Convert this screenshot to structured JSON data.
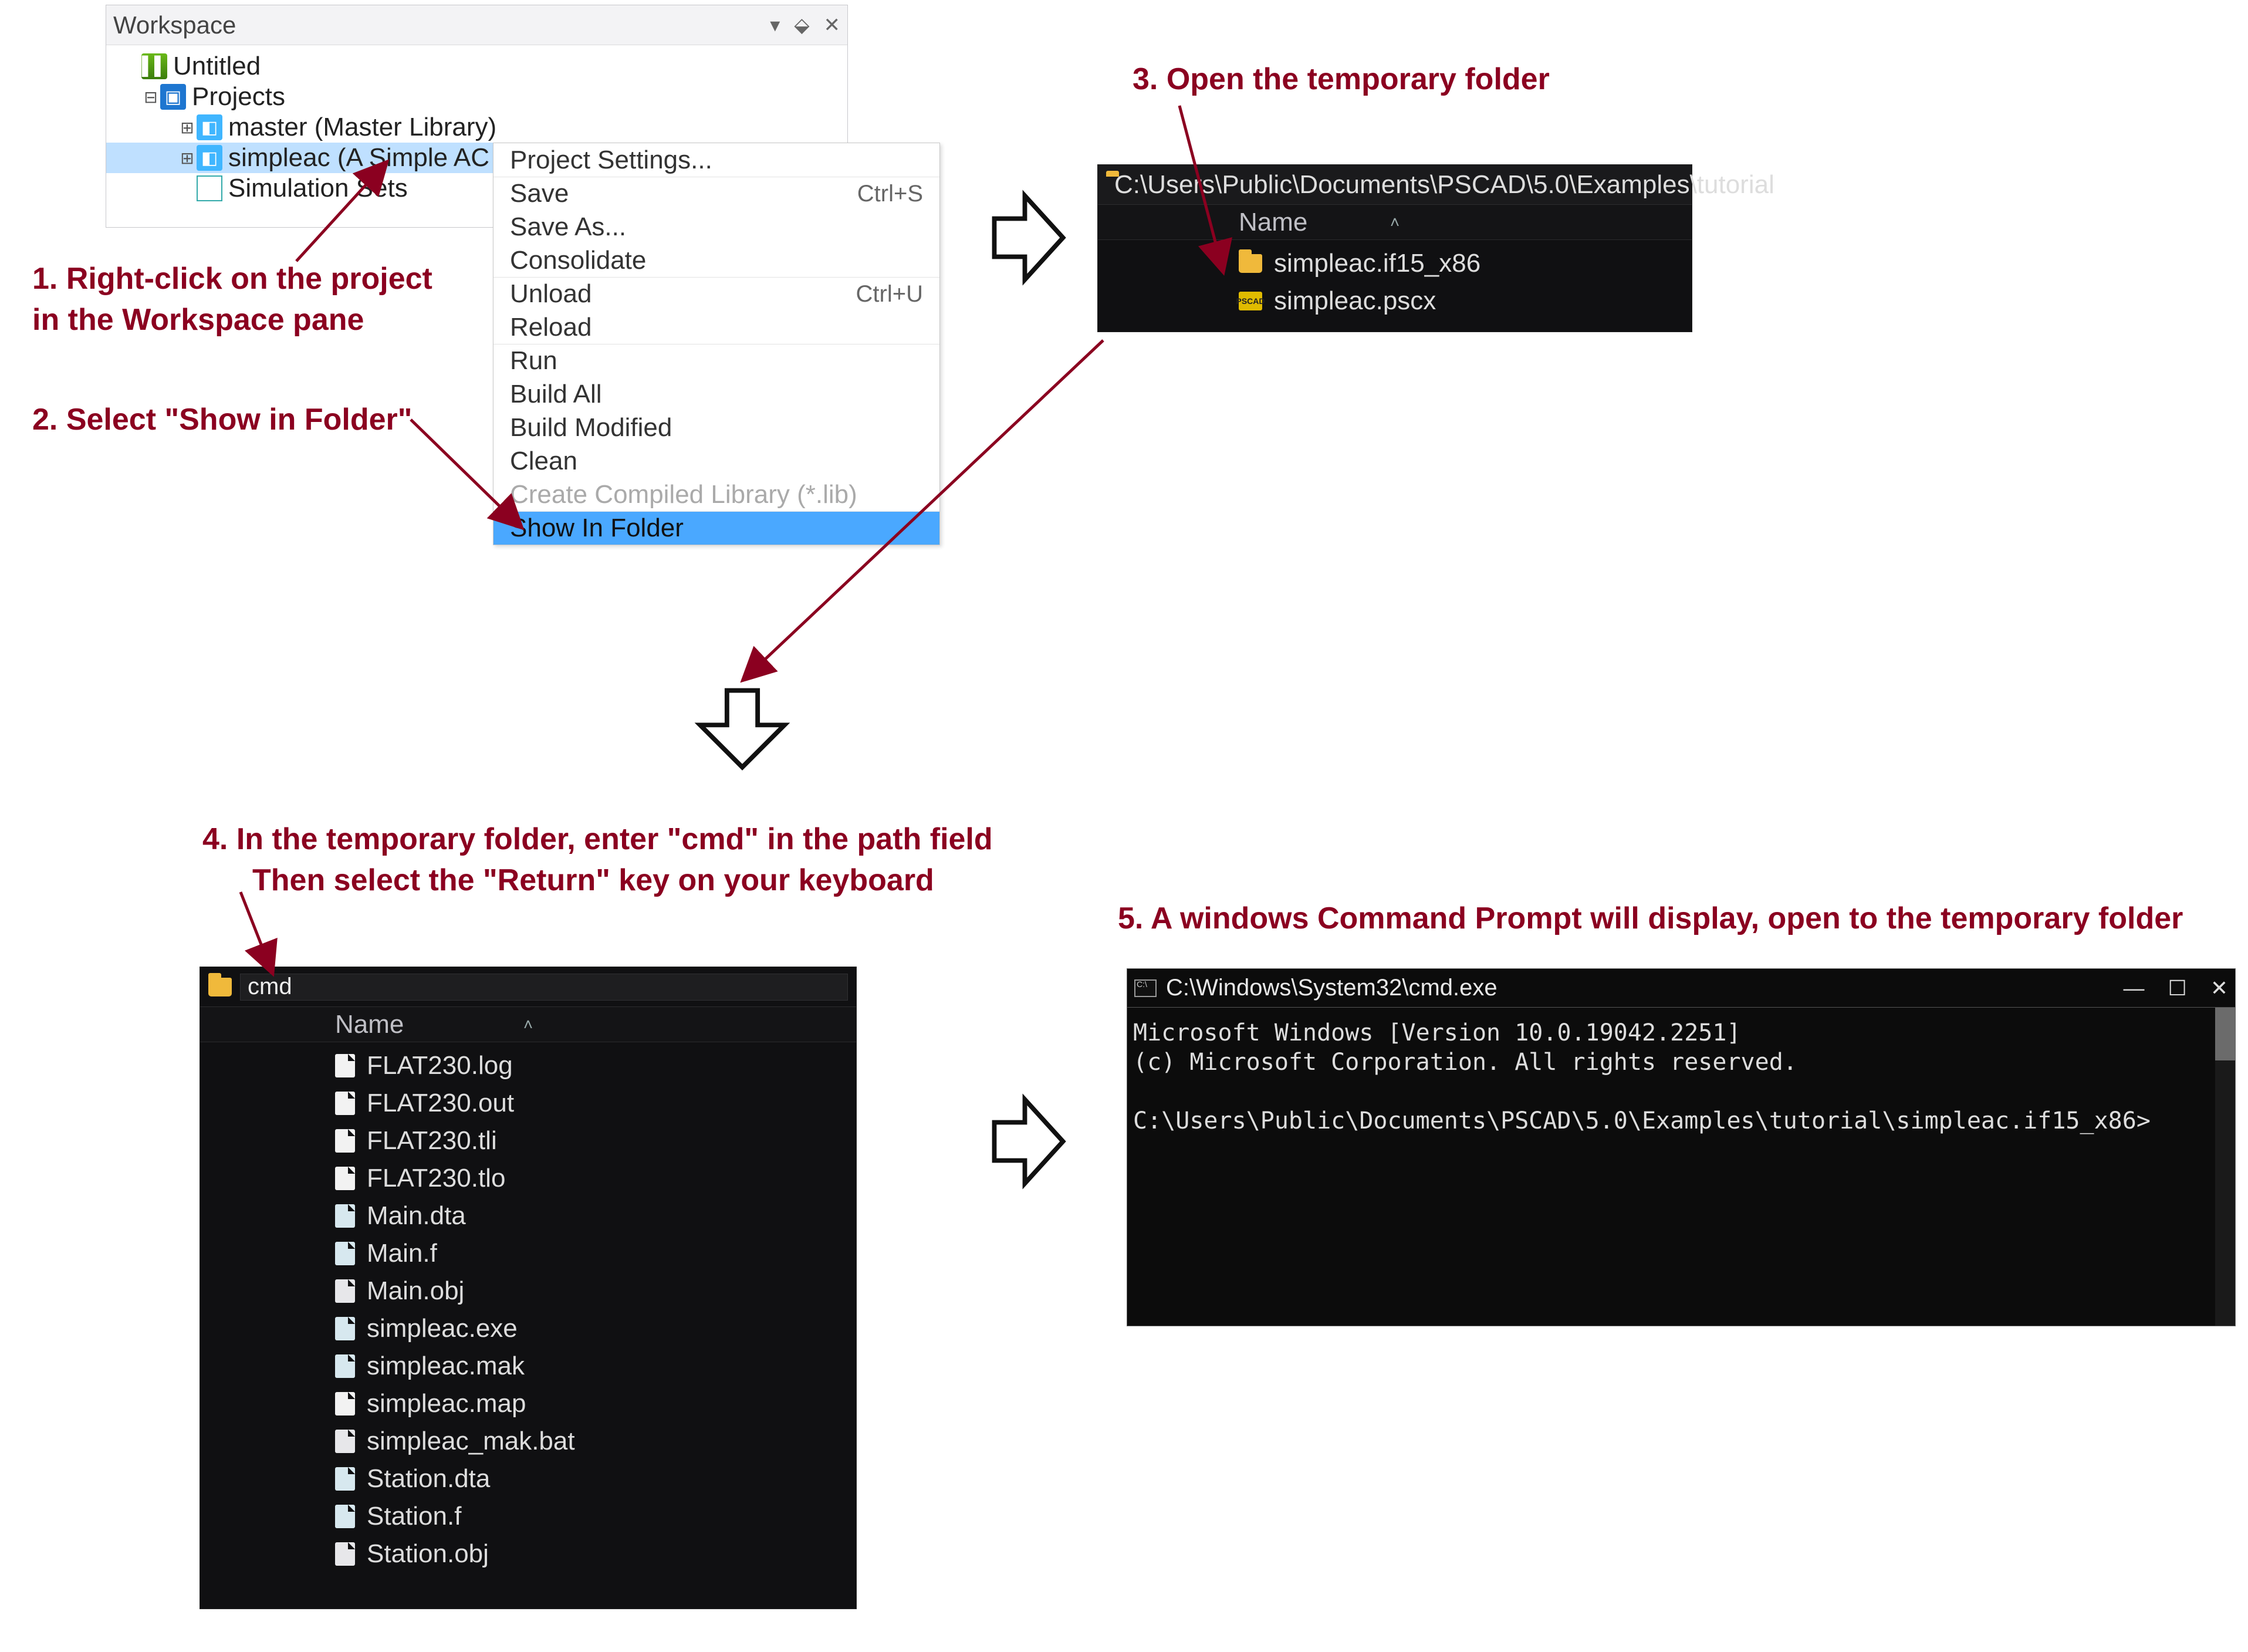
{
  "annotations": {
    "s1a": "1. Right-click on the project",
    "s1b": "in the Workspace pane",
    "s2": "2. Select \"Show in Folder\"",
    "s3": "3. Open the temporary folder",
    "s4a": "4. In the temporary folder, enter \"cmd\" in the path field",
    "s4b": "Then select the \"Return\" key on your keyboard",
    "s5": "5. A windows Command Prompt will display, open to the temporary folder"
  },
  "workspace": {
    "title": "Workspace",
    "tree": {
      "root": "Untitled",
      "projects": "Projects",
      "master": "master (Master Library)",
      "simpleac": "simpleac (A Simple AC Power System)",
      "simsets": "Simulation Sets"
    }
  },
  "context_menu": {
    "project_settings": "Project Settings...",
    "save": "Save",
    "save_kbd": "Ctrl+S",
    "save_as": "Save As...",
    "consolidate": "Consolidate",
    "unload": "Unload",
    "unload_kbd": "Ctrl+U",
    "reload": "Reload",
    "run": "Run",
    "build_all": "Build All",
    "build_modified": "Build Modified",
    "clean": "Clean",
    "create_lib": "Create Compiled Library (*.lib)",
    "show_in_folder": "Show In Folder"
  },
  "explorer1": {
    "path": "C:\\Users\\Public\\Documents\\PSCAD\\5.0\\Examples\\tutorial",
    "col_name": "Name",
    "items": {
      "folder": "simpleac.if15_x86",
      "pscx": "simpleac.pscx"
    }
  },
  "explorer2": {
    "addr_value": "cmd",
    "col_name": "Name",
    "files": [
      "FLAT230.log",
      "FLAT230.out",
      "FLAT230.tli",
      "FLAT230.tlo",
      "Main.dta",
      "Main.f",
      "Main.obj",
      "simpleac.exe",
      "simpleac.mak",
      "simpleac.map",
      "simpleac_mak.bat",
      "Station.dta",
      "Station.f",
      "Station.obj"
    ]
  },
  "cmd": {
    "title": "C:\\Windows\\System32\\cmd.exe",
    "line1": "Microsoft Windows [Version 10.0.19042.2251]",
    "line2": "(c) Microsoft Corporation. All rights reserved.",
    "prompt": "C:\\Users\\Public\\Documents\\PSCAD\\5.0\\Examples\\tutorial\\simpleac.if15_x86>"
  },
  "glyphs": {
    "dropdown": "▾",
    "pin": "⬙",
    "close": "✕",
    "plus": "⊞",
    "minus": "⊟",
    "chev": "˄",
    "min": "—",
    "max": "☐"
  }
}
